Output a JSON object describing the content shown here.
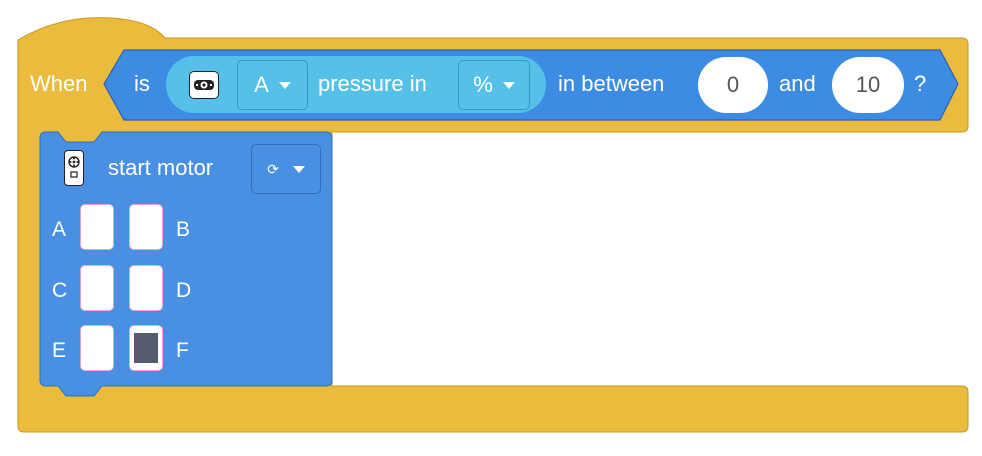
{
  "hat_block": {
    "when_label": "When",
    "color": "#eabb3d"
  },
  "condition": {
    "is_label": "is",
    "sensor_icon": "pressure-sensor-icon",
    "port_value": "A",
    "measure_label": "pressure in",
    "unit_value": "%",
    "between_label": "in between",
    "low_value": "0",
    "and_label": "and",
    "high_value": "10",
    "question_mark": "?",
    "color": "#3d8ce3"
  },
  "motor_block": {
    "icon": "hub-icon",
    "label": "start motor",
    "direction_icon": "⟳",
    "color": "#4a90e2",
    "ports": [
      {
        "label": "A",
        "selected": false
      },
      {
        "label": "B",
        "selected": false
      },
      {
        "label": "C",
        "selected": false
      },
      {
        "label": "D",
        "selected": false
      },
      {
        "label": "E",
        "selected": false
      },
      {
        "label": "F",
        "selected": true
      }
    ]
  }
}
